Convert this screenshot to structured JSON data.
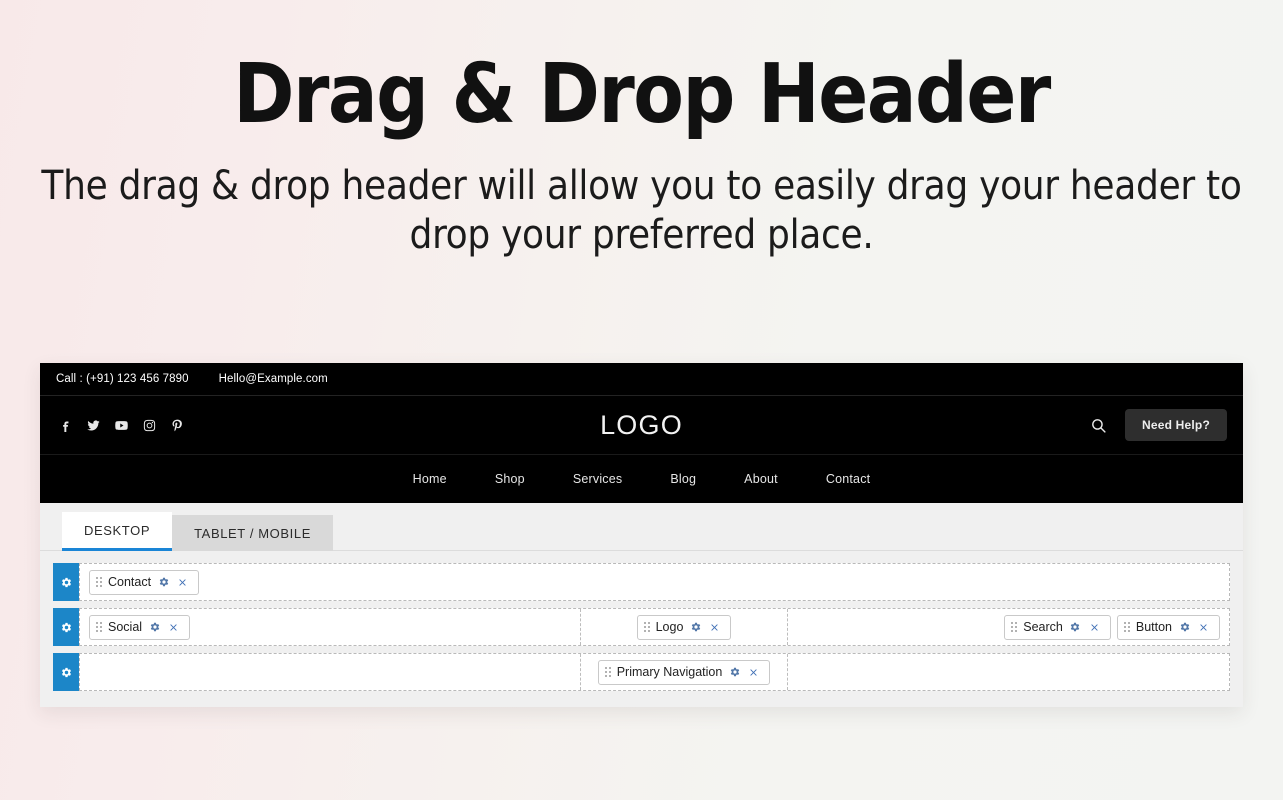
{
  "hero": {
    "title": "Drag & Drop Header",
    "subtitle": "The drag & drop header will allow you to easily drag your header to drop your preferred place."
  },
  "preview": {
    "topbar": {
      "phone": "Call : (+91) 123 456 7890",
      "email": "Hello@Example.com"
    },
    "socials": [
      {
        "name": "facebook-icon"
      },
      {
        "name": "twitter-icon"
      },
      {
        "name": "youtube-icon"
      },
      {
        "name": "instagram-icon"
      },
      {
        "name": "pinterest-icon"
      }
    ],
    "logo": "LOGO",
    "search_icon": "search-icon",
    "help_button": "Need Help?",
    "nav": [
      "Home",
      "Shop",
      "Services",
      "Blog",
      "About",
      "Contact"
    ]
  },
  "tabs": [
    {
      "label": "DESKTOP",
      "active": true
    },
    {
      "label": "TABLET / MOBILE",
      "active": false
    }
  ],
  "builder_rows": [
    {
      "handle_icon": "gear-icon",
      "cells": [
        {
          "align": "left",
          "widgets": [
            {
              "label": "Contact"
            }
          ]
        }
      ]
    },
    {
      "handle_icon": "gear-icon",
      "cells": [
        {
          "align": "left",
          "widgets": [
            {
              "label": "Social"
            }
          ]
        },
        {
          "align": "center",
          "widgets": [
            {
              "label": "Logo"
            }
          ]
        },
        {
          "align": "right",
          "widgets": [
            {
              "label": "Search"
            },
            {
              "label": "Button"
            }
          ]
        }
      ]
    },
    {
      "handle_icon": "gear-icon",
      "cells": [
        {
          "align": "left",
          "widgets": []
        },
        {
          "align": "center",
          "widgets": [
            {
              "label": "Primary Navigation"
            }
          ]
        },
        {
          "align": "right",
          "widgets": []
        }
      ]
    }
  ],
  "widget_icons": {
    "drag": "drag-grip-icon",
    "settings": "gear-icon",
    "remove": "close-icon"
  },
  "colors": {
    "accent_blue": "#1c86c8",
    "tab_underline": "#1a85d6",
    "preview_bg": "#000000",
    "help_btn_bg": "#2e2e2e"
  }
}
